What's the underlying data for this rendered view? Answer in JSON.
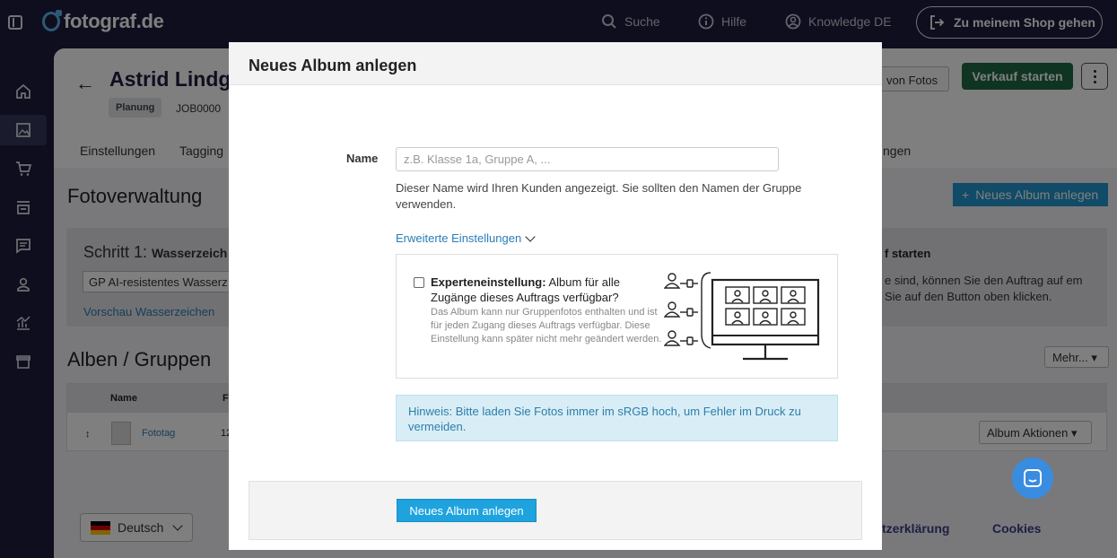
{
  "topbar": {
    "logo": "fotograf.de",
    "search": "Suche",
    "help": "Hilfe",
    "knowledge": "Knowledge DE",
    "shop_button": "Zu meinem Shop gehen"
  },
  "sidenav": {
    "items": [
      "home-icon",
      "photo-icon",
      "cart-icon",
      "shop-icon",
      "message-icon",
      "user-icon",
      "stats-icon",
      "store-icon"
    ],
    "active": "photo-icon"
  },
  "job": {
    "title": "Astrid Lindgr",
    "status": "Planung",
    "number": "JOB0000",
    "photos_button": "von Fotos",
    "sell_button": "Verkauf starten"
  },
  "tabs": [
    "Einstellungen",
    "Tagging",
    "ngen"
  ],
  "photo_mgmt": {
    "title": "Fotoverwaltung",
    "new_album_button": "Neues Album anlegen",
    "step_prefix": "Schritt 1:",
    "step_bold": "Wasserzeich",
    "watermark_select": "GP AI-resistentes Wasserz",
    "preview_link": "Vorschau Wasserzeichen",
    "right_title": "f starten",
    "right_text": "e sind, können Sie den Auftrag auf em Sie auf den Button oben klicken."
  },
  "albums": {
    "title": "Alben / Gruppen",
    "more_button": "Mehr...",
    "col_name": "Name",
    "col_fo": "Fo",
    "rows": [
      {
        "drag": "↕",
        "name": "Fototag",
        "count": "12",
        "actions": "Album Aktionen"
      }
    ]
  },
  "footer": {
    "language": "Deutsch",
    "privacy": "tzerklärung",
    "cookies": "Cookies"
  },
  "modal": {
    "title": "Neues Album anlegen",
    "name_label": "Name",
    "name_placeholder": "z.B. Klasse 1a, Gruppe A, ...",
    "name_help": "Dieser Name wird Ihren Kunden angezeigt. Sie sollten den Namen der Gruppe verwenden.",
    "advanced_link": "Erweiterte Einstellungen",
    "expert_title_bold": "Experteneinstellung:",
    "expert_title_rest": " Album für alle Zugänge dieses Auftrags verfügbar?",
    "expert_desc": "Das Album kann nur Gruppenfotos enthalten und ist für jeden Zugang dieses Auftrags verfügbar. Diese Einstellung kann später nicht mehr geändert werden.",
    "expert_checked": false,
    "hint": "Hinweis: Bitte laden Sie Fotos immer im sRGB hoch, um Fehler im Druck zu vermeiden.",
    "submit_button": "Neues Album anlegen"
  },
  "colors": {
    "sidebar_bg": "#1c1d3f",
    "sell_green": "#1f6b45",
    "link_blue": "#2a7db9",
    "submit_blue": "#1ea3de",
    "hint_bg": "#d9edf7"
  }
}
